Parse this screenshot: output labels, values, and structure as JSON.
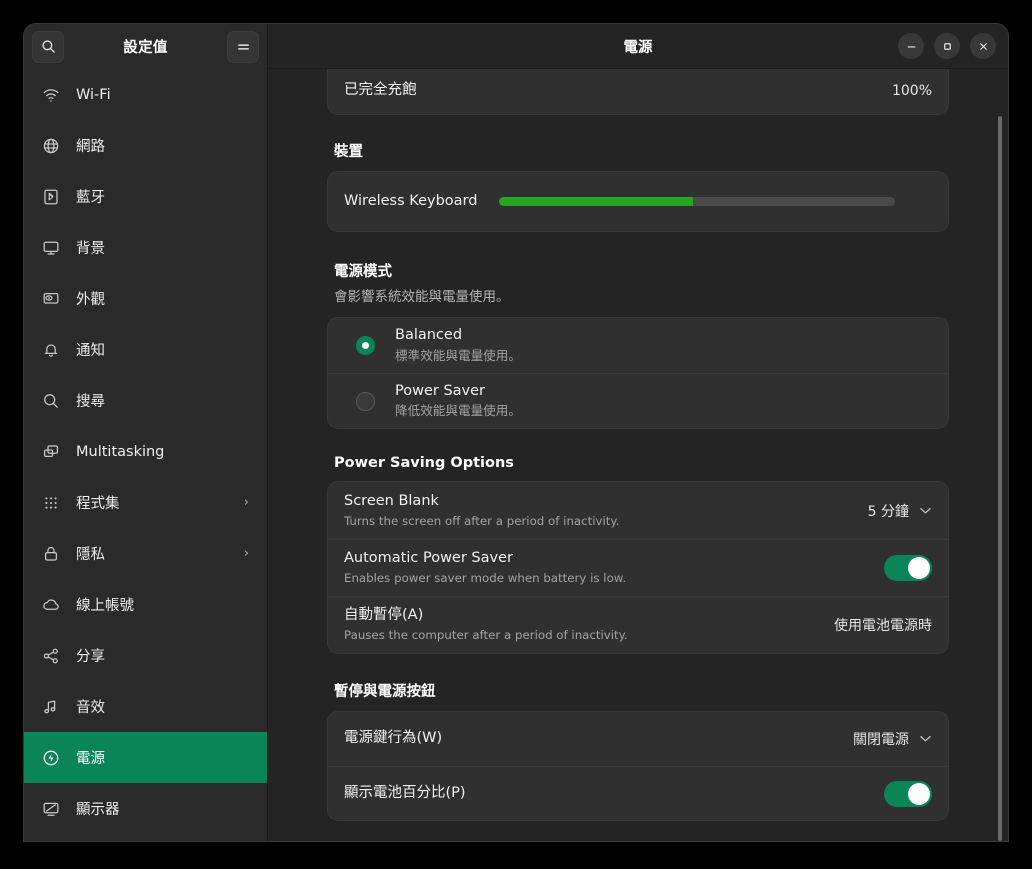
{
  "sidebar": {
    "search_icon": "search-icon",
    "title": "設定值",
    "menu_icon": "hamburger-menu-icon",
    "items": [
      {
        "label": "Wi-Fi",
        "icon": "wifi-icon",
        "chevron": "",
        "selected": false
      },
      {
        "label": "網路",
        "icon": "network-icon",
        "chevron": "",
        "selected": false
      },
      {
        "label": "藍牙",
        "icon": "bluetooth-icon",
        "chevron": "",
        "selected": false
      },
      {
        "label": "背景",
        "icon": "background-icon",
        "chevron": "",
        "selected": false
      },
      {
        "label": "外觀",
        "icon": "appearance-icon",
        "chevron": "",
        "selected": false
      },
      {
        "label": "通知",
        "icon": "bell-icon",
        "chevron": "",
        "selected": false
      },
      {
        "label": "搜尋",
        "icon": "search-icon",
        "chevron": "",
        "selected": false
      },
      {
        "label": "Multitasking",
        "icon": "multitasking-icon",
        "chevron": "",
        "selected": false
      },
      {
        "label": "程式集",
        "icon": "apps-grid-icon",
        "chevron": "›",
        "selected": false
      },
      {
        "label": "隱私",
        "icon": "lock-icon",
        "chevron": "›",
        "selected": false
      },
      {
        "label": "線上帳號",
        "icon": "cloud-icon",
        "chevron": "",
        "selected": false
      },
      {
        "label": "分享",
        "icon": "share-icon",
        "chevron": "",
        "selected": false
      },
      {
        "label": "音效",
        "icon": "sound-note-icon",
        "chevron": "",
        "selected": false
      },
      {
        "label": "電源",
        "icon": "power-icon",
        "chevron": "",
        "selected": true
      },
      {
        "label": "顯示器",
        "icon": "display-icon",
        "chevron": "",
        "selected": false
      }
    ]
  },
  "titlebar": {
    "title": "電源",
    "minimize": "−",
    "maximize": "□",
    "close": "✕"
  },
  "battery_card": {
    "label": "已完全充飽",
    "percent": "100%"
  },
  "devices": {
    "heading": "裝置",
    "items": [
      {
        "name": "Wireless Keyboard",
        "level_percent": 49
      }
    ]
  },
  "power_mode": {
    "heading": "電源模式",
    "subheading": "會影響系統效能與電量使用。",
    "options": [
      {
        "title": "Balanced",
        "sub": "標準效能與電量使用。",
        "selected": true
      },
      {
        "title": "Power Saver",
        "sub": "降低效能與電量使用。",
        "selected": false
      }
    ]
  },
  "power_saving": {
    "heading": "Power Saving Options",
    "rows": [
      {
        "title": "Screen Blank",
        "sub": "Turns the screen off after a period of inactivity.",
        "value": "5 分鐘",
        "control": "dropdown",
        "chevron": "⌄"
      },
      {
        "title": "Automatic Power Saver",
        "sub": "Enables power saver mode when battery is low.",
        "value": "",
        "control": "toggle",
        "toggle_on": true
      },
      {
        "title": "自動暫停(A)",
        "sub": "Pauses the computer after a period of inactivity.",
        "value": "使用電池電源時",
        "control": "value"
      }
    ]
  },
  "suspend_power_button": {
    "heading": "暫停與電源按鈕",
    "rows": [
      {
        "title": "電源鍵行為(W)",
        "sub": "",
        "value": "關閉電源",
        "control": "dropdown",
        "chevron": "⌄"
      },
      {
        "title": "顯示電池百分比(P)",
        "sub": "",
        "value": "",
        "control": "toggle",
        "toggle_on": true
      }
    ]
  },
  "colors": {
    "accent_green": "#0a8558",
    "battery_green": "#26a524",
    "window_bg": "#242424",
    "sidebar_bg": "#2a2a2a",
    "card_bg": "#303030"
  }
}
